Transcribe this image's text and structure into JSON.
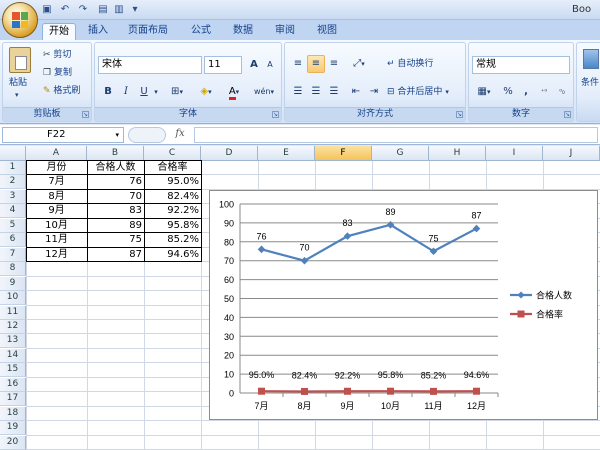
{
  "window": {
    "title_fragment": "Boo"
  },
  "tabs": [
    "开始",
    "插入",
    "页面布局",
    "公式",
    "数据",
    "审阅",
    "视图"
  ],
  "ribbon": {
    "clipboard": {
      "paste": "粘贴",
      "cut": "剪切",
      "copy": "复制",
      "format_painter": "格式刷",
      "label": "剪贴板"
    },
    "font": {
      "name": "宋体",
      "size": "11",
      "bold": "B",
      "italic": "I",
      "underline": "U",
      "grow": "A",
      "shrink": "A",
      "wen": "wén",
      "label": "字体"
    },
    "alignment": {
      "wrap": "自动换行",
      "merge": "合并后居中",
      "label": "对齐方式"
    },
    "number": {
      "format": "常规",
      "percent": "%",
      "comma": ",",
      "label": "数字"
    },
    "styles": {
      "conditional": "条件"
    }
  },
  "formula_bar": {
    "name_box": "F22",
    "fx": "fx",
    "value": ""
  },
  "sheet": {
    "columns": [
      "A",
      "B",
      "C",
      "D",
      "E",
      "F",
      "G",
      "H",
      "I",
      "J"
    ],
    "selected_column": "F",
    "rows": [
      "1",
      "2",
      "3",
      "4",
      "5",
      "6",
      "7",
      "8",
      "9",
      "10",
      "11",
      "12",
      "13",
      "14",
      "15",
      "16",
      "17",
      "18",
      "19",
      "20"
    ],
    "headers": [
      "月份",
      "合格人数",
      "合格率"
    ],
    "data": [
      [
        "7月",
        "76",
        "95.0%"
      ],
      [
        "8月",
        "70",
        "82.4%"
      ],
      [
        "9月",
        "83",
        "92.2%"
      ],
      [
        "10月",
        "89",
        "95.8%"
      ],
      [
        "11月",
        "75",
        "85.2%"
      ],
      [
        "12月",
        "87",
        "94.6%"
      ]
    ]
  },
  "chart_data": {
    "type": "line",
    "categories": [
      "7月",
      "8月",
      "9月",
      "10月",
      "11月",
      "12月"
    ],
    "series": [
      {
        "name": "合格人数",
        "values": [
          76,
          70,
          83,
          89,
          75,
          87
        ],
        "labels": [
          "76",
          "70",
          "83",
          "89",
          "75",
          "87"
        ],
        "color": "#4f81bd"
      },
      {
        "name": "合格率",
        "values": [
          0.95,
          0.824,
          0.922,
          0.958,
          0.852,
          0.946
        ],
        "labels": [
          "95.0%",
          "82.4%",
          "92.2%",
          "95.8%",
          "85.2%",
          "94.6%"
        ],
        "color": "#c0504d"
      }
    ],
    "yticks": [
      "0",
      "10",
      "20",
      "30",
      "40",
      "50",
      "60",
      "70",
      "80",
      "90",
      "100"
    ],
    "ylim": [
      0,
      100
    ],
    "grid": true,
    "legend": "right"
  }
}
